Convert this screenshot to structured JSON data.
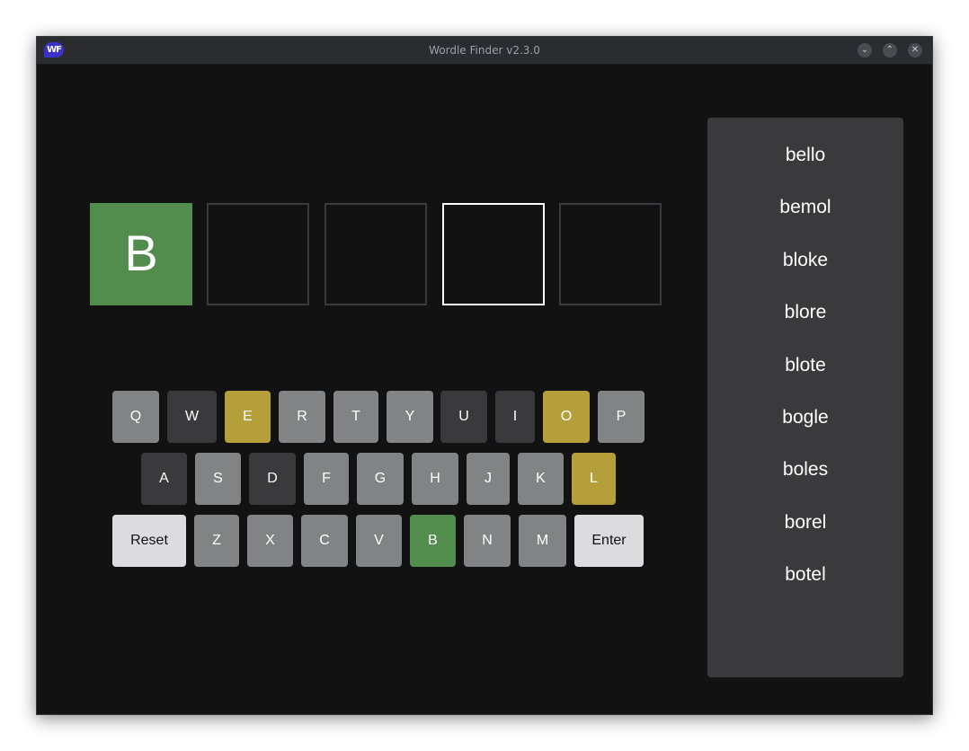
{
  "window": {
    "title": "Wordle Finder v2.3.0",
    "icon_text": "WF",
    "controls": {
      "minimize": "⌄",
      "maximize": "⌃",
      "close": "✕"
    }
  },
  "colors": {
    "correct": "#538d4e",
    "present": "#b59f3b",
    "absent": "#3a3a3c",
    "unused": "#818384",
    "action_key": "#dcdcde"
  },
  "tiles": [
    {
      "letter": "B",
      "state": "correct"
    },
    {
      "letter": "",
      "state": "empty"
    },
    {
      "letter": "",
      "state": "empty"
    },
    {
      "letter": "",
      "state": "active"
    },
    {
      "letter": "",
      "state": "empty"
    }
  ],
  "keyboard": {
    "row1": [
      {
        "label": "Q",
        "state": "unused"
      },
      {
        "label": "W",
        "state": "absent"
      },
      {
        "label": "E",
        "state": "present"
      },
      {
        "label": "R",
        "state": "unused"
      },
      {
        "label": "T",
        "state": "unused"
      },
      {
        "label": "Y",
        "state": "unused"
      },
      {
        "label": "U",
        "state": "absent"
      },
      {
        "label": "I",
        "state": "absent"
      },
      {
        "label": "O",
        "state": "present"
      },
      {
        "label": "P",
        "state": "unused"
      }
    ],
    "row2": [
      {
        "label": "A",
        "state": "absent"
      },
      {
        "label": "S",
        "state": "unused"
      },
      {
        "label": "D",
        "state": "absent"
      },
      {
        "label": "F",
        "state": "unused"
      },
      {
        "label": "G",
        "state": "unused"
      },
      {
        "label": "H",
        "state": "unused"
      },
      {
        "label": "J",
        "state": "unused"
      },
      {
        "label": "K",
        "state": "unused"
      },
      {
        "label": "L",
        "state": "present"
      }
    ],
    "row3": [
      {
        "label": "Reset",
        "state": "action"
      },
      {
        "label": "Z",
        "state": "unused"
      },
      {
        "label": "X",
        "state": "unused"
      },
      {
        "label": "C",
        "state": "unused"
      },
      {
        "label": "V",
        "state": "unused"
      },
      {
        "label": "B",
        "state": "correct"
      },
      {
        "label": "N",
        "state": "unused"
      },
      {
        "label": "M",
        "state": "unused"
      },
      {
        "label": "Enter",
        "state": "action"
      }
    ]
  },
  "results": [
    "bello",
    "bemol",
    "bloke",
    "blore",
    "blote",
    "bogle",
    "boles",
    "borel",
    "botel"
  ]
}
